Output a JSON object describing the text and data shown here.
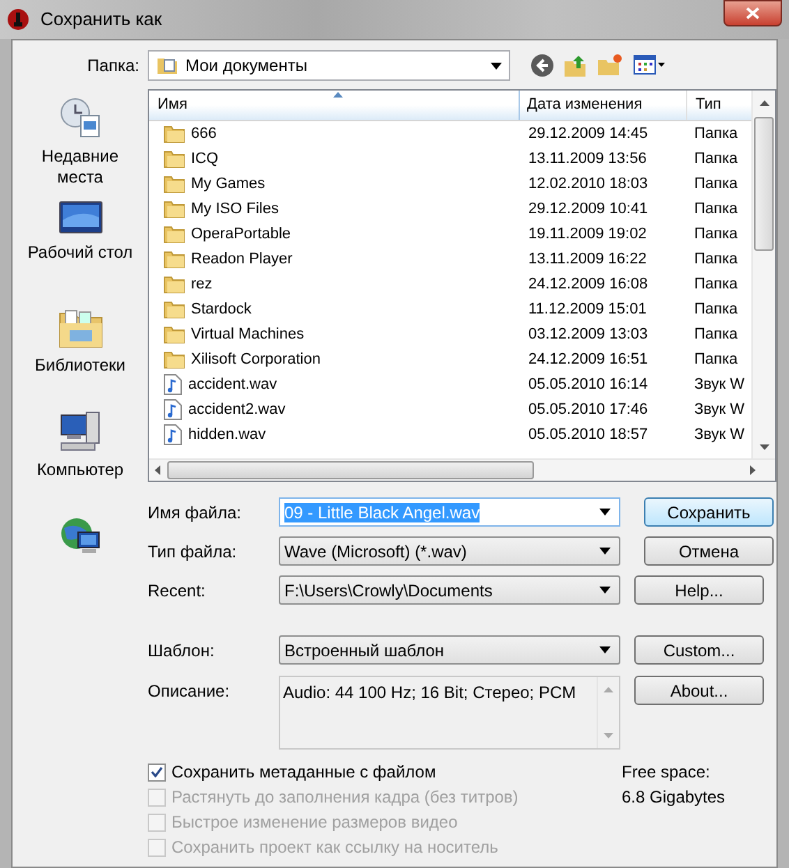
{
  "window": {
    "title": "Сохранить как"
  },
  "places": [
    {
      "label": "Недавние места",
      "kind": "recent"
    },
    {
      "label": "Рабочий стол",
      "kind": "desktop"
    },
    {
      "label": "Библиотеки",
      "kind": "libraries"
    },
    {
      "label": "Компьютер",
      "kind": "computer"
    },
    {
      "kind": "network"
    }
  ],
  "folder": {
    "label": "Папка:",
    "value": "Мои документы"
  },
  "table": {
    "columns": [
      "Имя",
      "Дата изменения",
      "Тип"
    ],
    "rows": [
      {
        "name": "666",
        "date": "29.12.2009 14:45",
        "type": "Папка",
        "kind": "folder"
      },
      {
        "name": "ICQ",
        "date": "13.11.2009 13:56",
        "type": "Папка",
        "kind": "folder"
      },
      {
        "name": "My Games",
        "date": "12.02.2010 18:03",
        "type": "Папка",
        "kind": "folder"
      },
      {
        "name": "My ISO Files",
        "date": "29.12.2009 10:41",
        "type": "Папка",
        "kind": "folder"
      },
      {
        "name": "OperaPortable",
        "date": "19.11.2009 19:02",
        "type": "Папка",
        "kind": "folder"
      },
      {
        "name": "Readon Player",
        "date": "13.11.2009 16:22",
        "type": "Папка",
        "kind": "folder"
      },
      {
        "name": "rez",
        "date": "24.12.2009 16:08",
        "type": "Папка",
        "kind": "folder"
      },
      {
        "name": "Stardock",
        "date": "11.12.2009 15:01",
        "type": "Папка",
        "kind": "folder"
      },
      {
        "name": "Virtual Machines",
        "date": "03.12.2009 13:03",
        "type": "Папка",
        "kind": "folder"
      },
      {
        "name": "Xilisoft Corporation",
        "date": "24.12.2009 16:51",
        "type": "Папка",
        "kind": "folder"
      },
      {
        "name": "accident.wav",
        "date": "05.05.2010 16:14",
        "type": "Звук W",
        "kind": "audio"
      },
      {
        "name": "accident2.wav",
        "date": "05.05.2010 17:46",
        "type": "Звук W",
        "kind": "audio"
      },
      {
        "name": "hidden.wav",
        "date": "05.05.2010 18:57",
        "type": "Звук W",
        "kind": "audio"
      }
    ]
  },
  "fields": [
    {
      "label": "Имя файла:",
      "value": "09 - Little Black Angel.wav",
      "selected": true,
      "button": "Сохранить"
    },
    {
      "label": "Тип файла:",
      "value": "Wave (Microsoft) (*.wav)",
      "selected": false,
      "button": "Отмена"
    },
    {
      "label": "Recent:",
      "value": "F:\\Users\\Crowly\\Documents",
      "selected": false,
      "button": "Help..."
    },
    {
      "label": "Шаблон:",
      "value": "Встроенный шаблон",
      "selected": false,
      "button": "Custom..."
    }
  ],
  "description": {
    "label": "Описание:",
    "value": "Audio: 44 100 Hz; 16 Bit; Стерео; PCM",
    "button": "About..."
  },
  "options": [
    {
      "label": "Сохранить метаданные с файлом",
      "checked": true,
      "disabled": false
    },
    {
      "label": "Растянуть до заполнения кадра (без титров)",
      "checked": false,
      "disabled": true
    },
    {
      "label": "Быстрое изменение размеров видео",
      "checked": false,
      "disabled": true
    },
    {
      "label": "Сохранить проект как ссылку на носитель",
      "checked": false,
      "disabled": true
    }
  ],
  "free_space": {
    "label": "Free space:",
    "value": "6.8 Gigabytes"
  }
}
